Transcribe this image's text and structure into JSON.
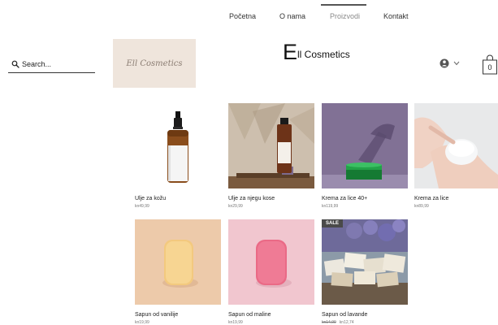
{
  "nav": {
    "items": [
      {
        "label": "Početna"
      },
      {
        "label": "O nama"
      },
      {
        "label": "Proizvodi"
      },
      {
        "label": "Kontakt"
      }
    ],
    "active_index": 2
  },
  "search": {
    "placeholder": "Search..."
  },
  "logo": {
    "text": "Ell Cosmetics"
  },
  "site_title": {
    "initial": "E",
    "rest": "ll Cosmetics"
  },
  "cart": {
    "count": "0"
  },
  "products": [
    {
      "name": "Ulje za kožu",
      "price": "kn49,99"
    },
    {
      "name": "Ulje za njegu kose",
      "price": "kn29,99"
    },
    {
      "name": "Krema za lice 40+",
      "price": "kn119,99"
    },
    {
      "name": "Krema za lice",
      "price": "kn89,99"
    },
    {
      "name": "Sapun od vanilije",
      "price": "kn19,99"
    },
    {
      "name": "Sapun od maline",
      "price": "kn19,99"
    },
    {
      "name": "Sapun od lavande",
      "price_old": "kn14,99",
      "price": "kn12,74",
      "badge": "SALE"
    }
  ],
  "colors": {
    "logo_background": "#efe5dc",
    "sale_badge": "#4a4a4a",
    "nav_active": "#8a8a8a"
  },
  "icons": [
    "search-icon",
    "user-icon",
    "chevron-down-icon",
    "shopping-bag-icon"
  ]
}
